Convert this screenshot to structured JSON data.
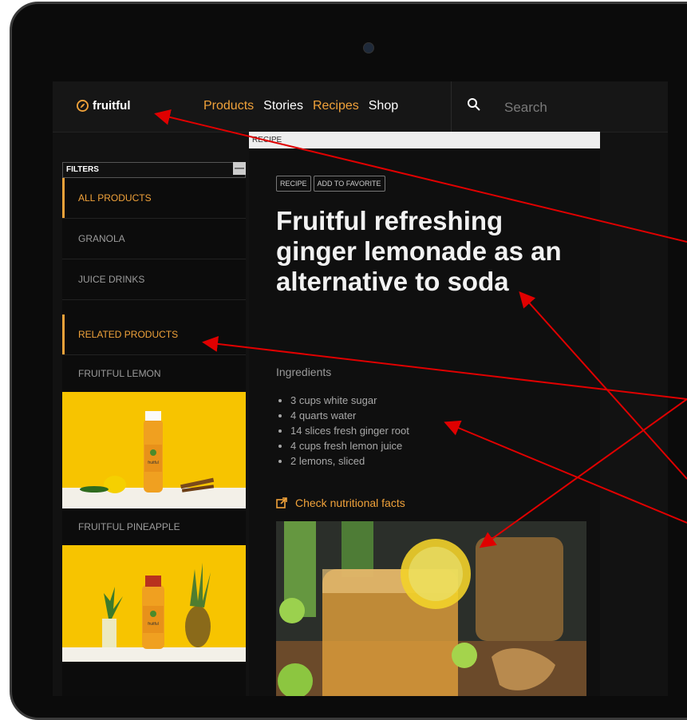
{
  "brand": {
    "name": "fruitful"
  },
  "nav": {
    "items": [
      {
        "label": "Products",
        "active": true
      },
      {
        "label": "Stories",
        "active": false
      },
      {
        "label": "Recipes",
        "active": true
      },
      {
        "label": "Shop",
        "active": false
      }
    ]
  },
  "search": {
    "placeholder": "Search"
  },
  "sidebar": {
    "filters_label": "FILTERS",
    "collapse_symbol": "—",
    "items": [
      {
        "label": "ALL PRODUCTS"
      },
      {
        "label": "GRANOLA"
      },
      {
        "label": "JUICE DRINKS"
      }
    ],
    "related_label": "RELATED PRODUCTS",
    "products": [
      {
        "label": "FRUITFUL LEMON",
        "bottle_label": "fruitful"
      },
      {
        "label": "FRUITFUL PINEAPPLE",
        "bottle_label": "fruitful"
      }
    ]
  },
  "breadcrumb": "RECIPE",
  "article": {
    "tags": [
      "RECIPE",
      "ADD TO FAVORITE"
    ],
    "title": "Fruitful refreshing ginger lemonade as an alternative to soda",
    "ingredients_heading": "Ingredients",
    "ingredients": [
      "3 cups white sugar",
      "4 quarts water",
      "14 slices fresh ginger root",
      "4 cups fresh lemon juice",
      "2 lemons, sliced"
    ],
    "nutrition_link": "Check nutritional facts"
  },
  "colors": {
    "accent": "#f0a23a",
    "background": "#121212",
    "annotation": "#e00000",
    "lemon_bg": "#f7c400"
  }
}
